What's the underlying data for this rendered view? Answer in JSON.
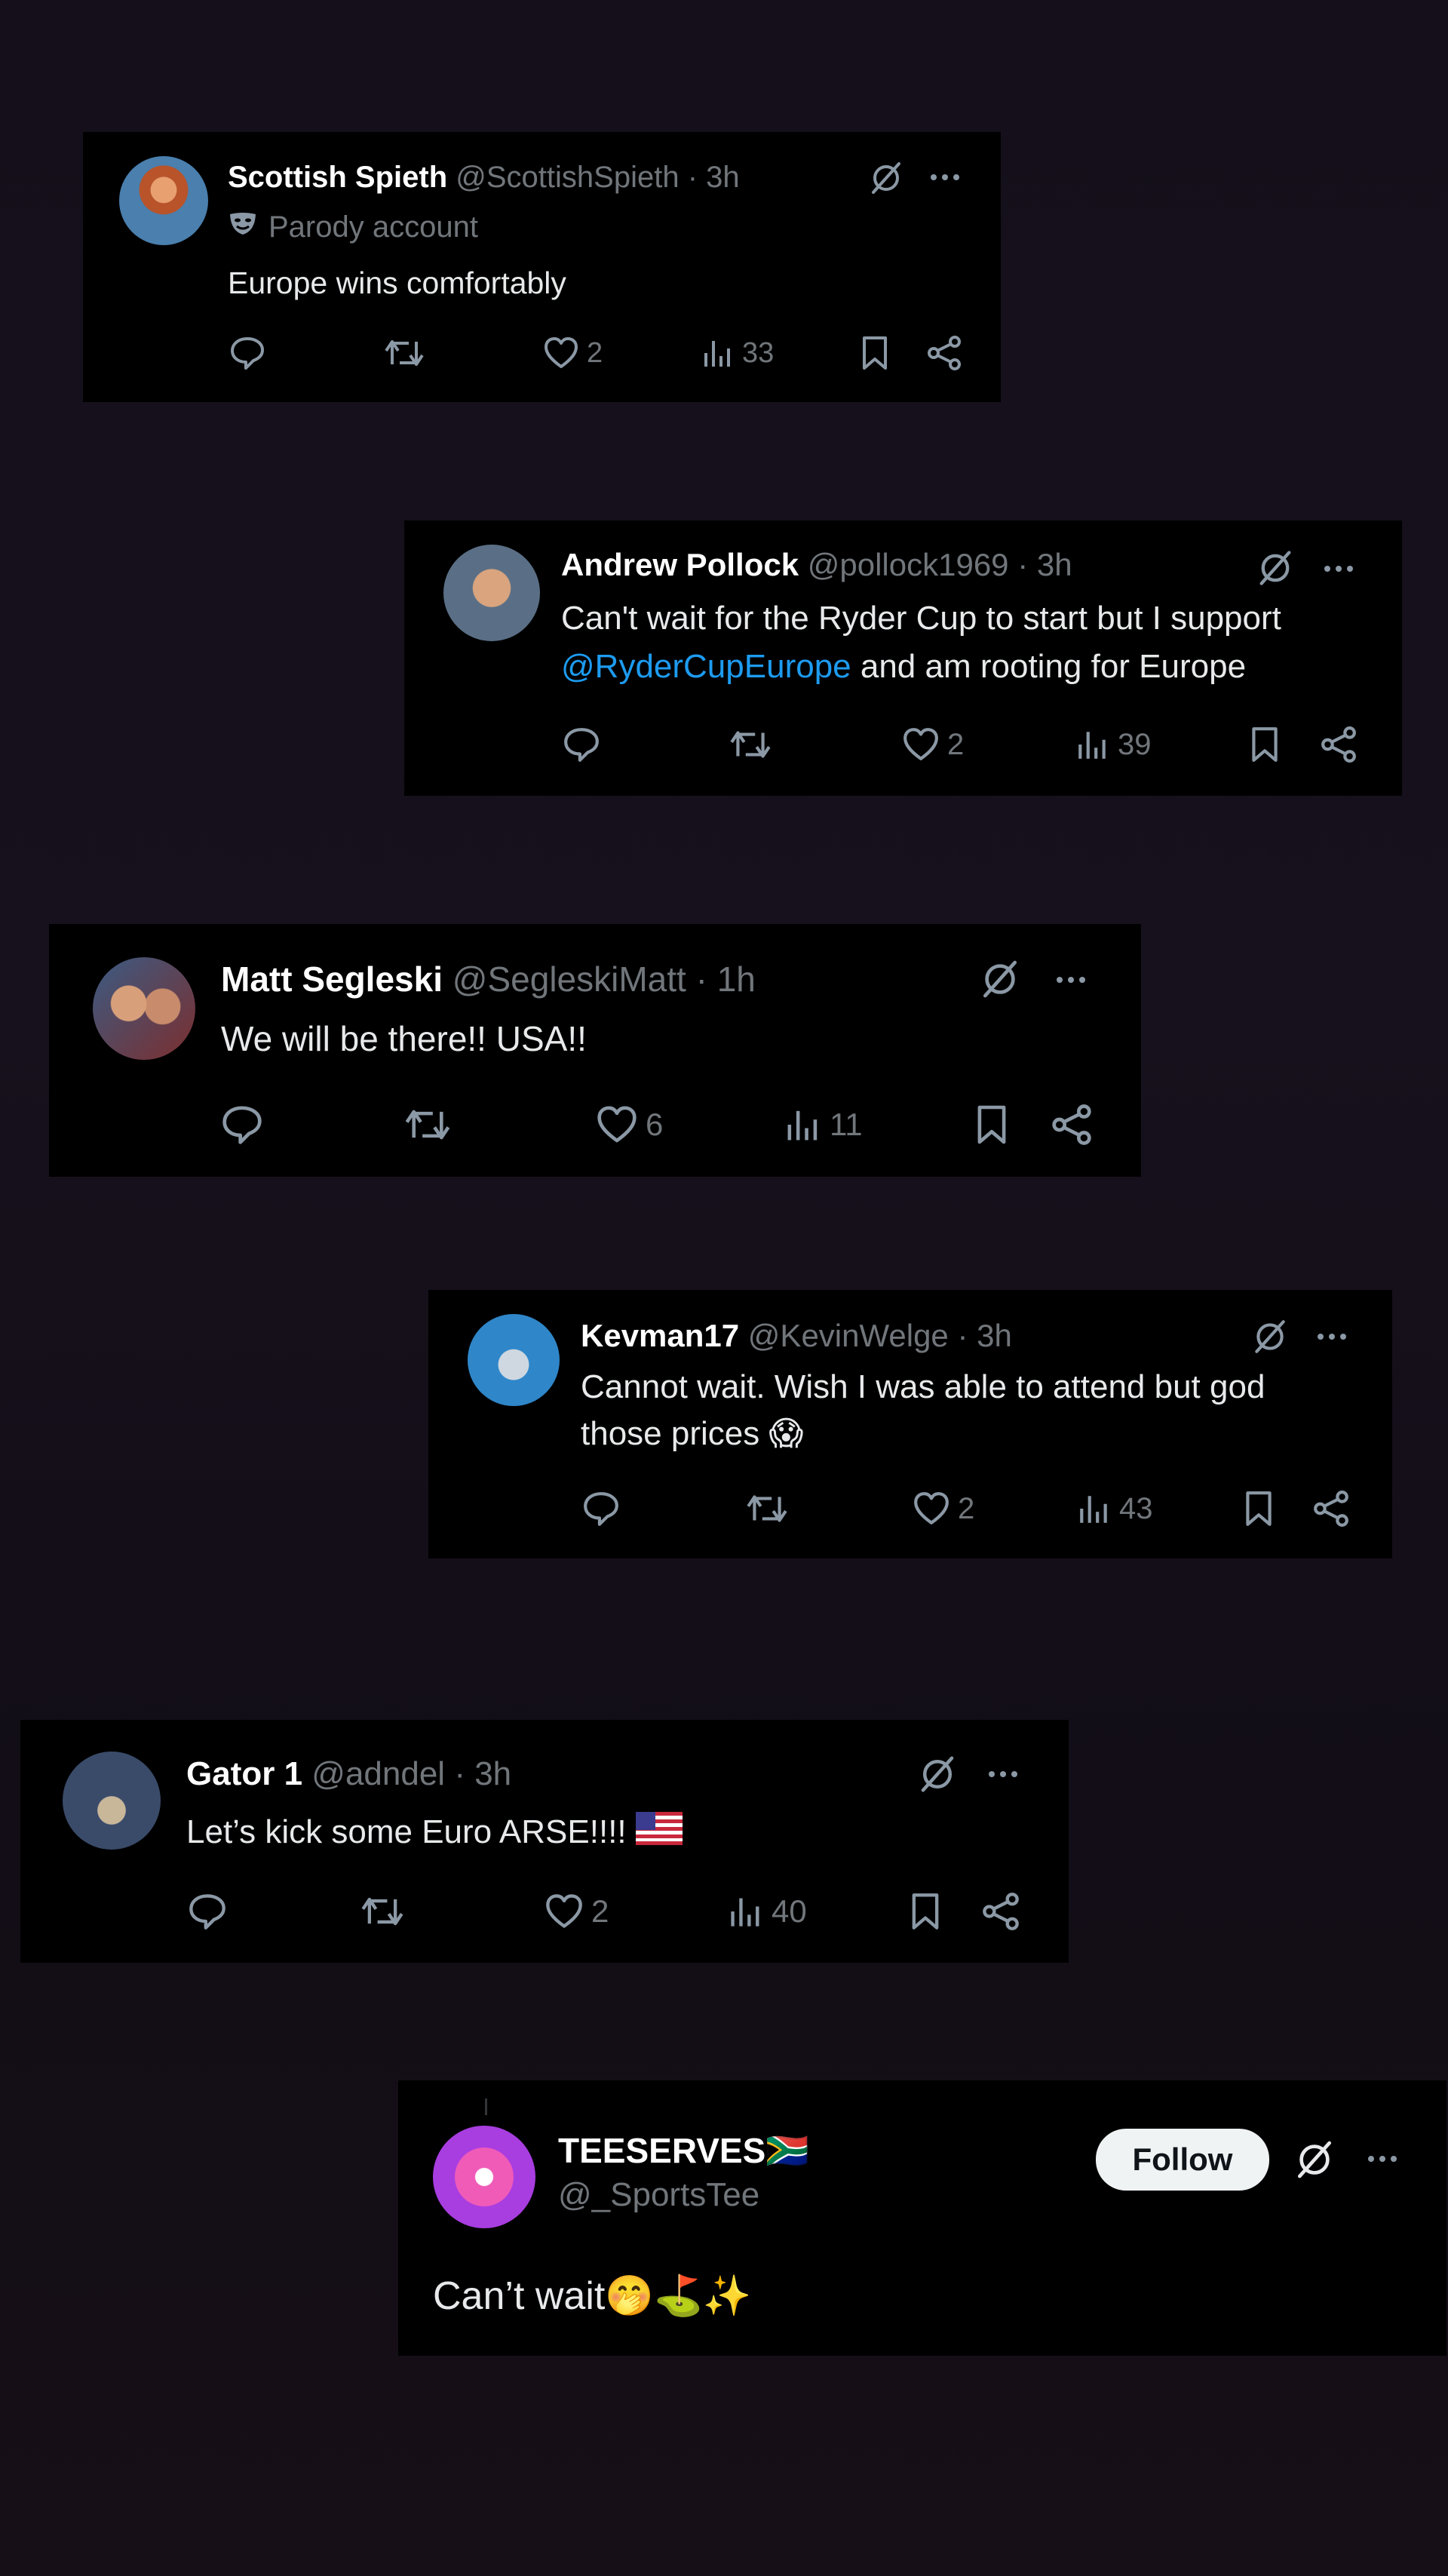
{
  "tweets": [
    {
      "name": "Scottish Spieth",
      "handle": "@ScottishSpieth",
      "time": "· 3h",
      "badge": "Parody account",
      "text": "Europe wins comfortably",
      "likes": "2",
      "views": "33"
    },
    {
      "name": "Andrew Pollock",
      "handle": "@pollock1969",
      "time": "· 3h",
      "text_line1": "Can't wait for the Ryder Cup to start but I support",
      "mention": "@RyderCupEurope",
      "text_line2": " and am rooting for Europe",
      "likes": "2",
      "views": "39"
    },
    {
      "name": "Matt Segleski",
      "handle": "@SegleskiMatt",
      "time": "· 1h",
      "text": "We will be there!! USA!!",
      "likes": "6",
      "views": "11"
    },
    {
      "name": "Kevman17",
      "handle": "@KevinWelge",
      "time": "· 3h",
      "text_line1": "Cannot wait. Wish I was able to attend but god",
      "text_line2": "those prices 😱",
      "likes": "2",
      "views": "43"
    },
    {
      "name": "Gator 1",
      "handle": "@adndel",
      "time": "· 3h",
      "text": "Let’s kick some Euro ARSE!!!!",
      "likes": "2",
      "views": "40"
    },
    {
      "name": "TEESERVES🇿🇦",
      "handle": "@_SportsTee",
      "follow_label": "Follow",
      "text": "Can’t wait🤭⛳✨"
    }
  ],
  "icons": [
    "reply-icon",
    "retweet-icon",
    "like-icon",
    "views-icon",
    "bookmark-icon",
    "share-icon",
    "grok-icon",
    "more-icon",
    "parody-mask-icon"
  ],
  "colors": {
    "accent": "#1d9bf0",
    "muted": "#71767b",
    "card": "#000000",
    "text": "#e7e9ea"
  }
}
